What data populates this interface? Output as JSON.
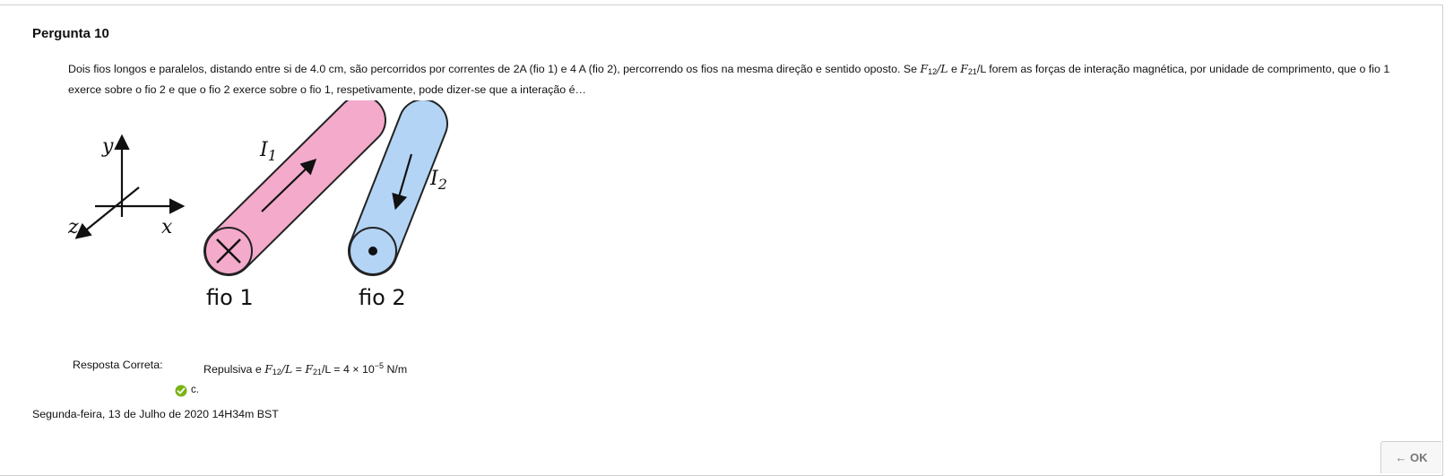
{
  "question": {
    "title": "Pergunta 10",
    "text_part1": "Dois fios longos e paralelos, distando entre si de 4.0 cm, são percorridos por correntes de 2A (fio 1) e 4 A (fio 2), percorrendo os fios na mesma direção e sentido oposto. Se ",
    "f": "F",
    "sub12": "12",
    "slash_l": "/L",
    "and": " e ",
    "sub21": "21",
    "slash_L_plain": "/L",
    "text_part2": " forem as forças de interação magnética, por unidade de comprimento, que o fio 1 exerce sobre o fio 2 e que o fio 2 exerce sobre o fio 1, respetivamente, pode dizer-se que a interação é…"
  },
  "figure": {
    "axis_y": "y",
    "axis_x": "x",
    "axis_z": "z",
    "current_1": "I",
    "current_1_sub": "1",
    "current_2": "I",
    "current_2_sub": "2",
    "wire_1_label": "fio 1",
    "wire_2_label": "fio 2",
    "wire_1_color": "#f4aacb",
    "wire_2_color": "#b3d4f5"
  },
  "answer": {
    "label": "Resposta Correta:",
    "prefix": "Repulsiva e ",
    "f": "F",
    "sub12": "12",
    "slash_l": "/L",
    "equals": " = ",
    "sub21": "21",
    "slash_L": "/L",
    "value": " = 4 × 10",
    "exponent": "−5",
    "unit": "  N/m",
    "choice": "c.",
    "check_color": "#7ab317"
  },
  "footer": {
    "date": "Segunda-feira, 13 de Julho de 2020 14H34m BST",
    "ok_button": "← OK"
  }
}
